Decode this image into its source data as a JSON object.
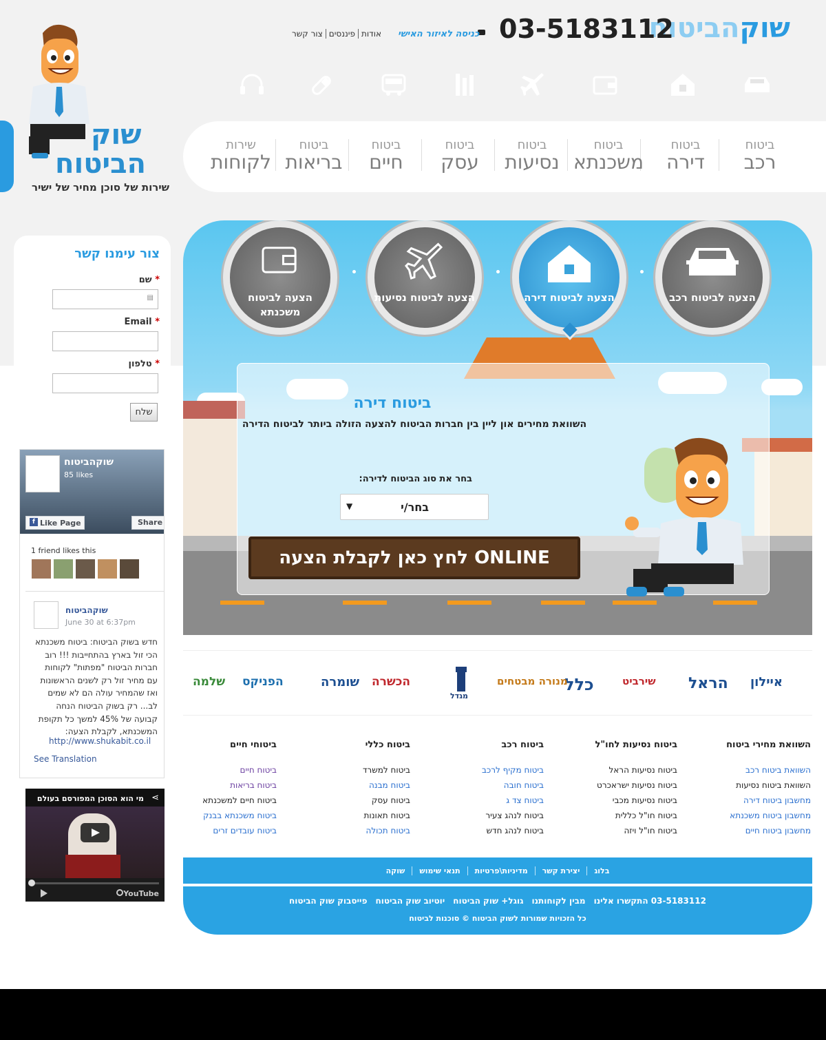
{
  "header": {
    "brand_part1": "שוק",
    "brand_part2": "הביטוח",
    "phone": "03-5183112",
    "login_link": "כניסה לאיזור האישי",
    "top_links": [
      "אודות",
      "פיננסים",
      "צור קשר"
    ]
  },
  "logo": {
    "line1": "שוק",
    "line2": "הביטוח",
    "tagline": "שירות של סוכן מחיר של ישיר"
  },
  "category_icons": [
    "car-icon",
    "home-icon",
    "wallet-icon",
    "plane-icon",
    "tools-icon",
    "bus-icon",
    "health-icon",
    "headset-icon"
  ],
  "nav": [
    {
      "top": "ביטוח",
      "bottom": "רכב"
    },
    {
      "top": "ביטוח",
      "bottom": "דירה"
    },
    {
      "top": "ביטוח",
      "bottom": "משכנתא"
    },
    {
      "top": "ביטוח",
      "bottom": "נסיעות"
    },
    {
      "top": "ביטוח",
      "bottom": "עסק"
    },
    {
      "top": "ביטוח",
      "bottom": "חיים"
    },
    {
      "top": "ביטוח",
      "bottom": "בריאות"
    },
    {
      "top": "שירות",
      "bottom": "לקוחות"
    }
  ],
  "hero": {
    "circles": [
      {
        "label": "הצעה לביטוח רכב",
        "icon": "car-icon",
        "active": false
      },
      {
        "label": "הצעה לביטוח דירה",
        "icon": "home-icon",
        "active": true
      },
      {
        "label": "הצעה לביטוח נסיעות",
        "icon": "plane-icon",
        "active": false
      },
      {
        "label": "הצעה לביטוח משכנתא",
        "icon": "wallet-icon",
        "active": false
      }
    ],
    "title": "ביטוח דירה",
    "subtitle": "השוואת מחירים און ליין בין חברות הביטוח להצעה הזולה ביותר לביטוח הדירה",
    "select_label": "בחר את סוג הביטוח לדירה:",
    "select_value": "בחר/י",
    "cta": "לחץ כאן לקבלת הצעה ONLINE"
  },
  "contact": {
    "title": "צור עימנו קשר",
    "name_label": "שם",
    "email_label": "Email",
    "phone_label": "טלפון",
    "required_mark": "*",
    "submit": "שלח"
  },
  "facebook": {
    "page_name": "שוקהביטוח",
    "likes": "85 likes",
    "like_button": "Like Page",
    "share_button": "Share",
    "friends": "1 friend likes this",
    "post_author": "שוקהביטוח",
    "post_date": "June 30 at 6:37pm",
    "post_text": "חדש בשוק הביטוח: ביטוח משכנתא הכי זול בארץ בהתחייבות !!! רוב חברות הביטוח \"מפתות\" לקוחות עם מחיר זול רק לשנים הראשונות ואז שהמחיר עולה הם לא שמים לב... רק בשוק הביטוח הנחה קבועה של 45% למשך כל תקופת המשכנתא, לקבלת הצעה:",
    "post_link": "http://www.shukabit.co.il",
    "translate": "See Translation"
  },
  "youtube": {
    "title": "מי הוא הסוכן המפורסם בעולם",
    "logo": "YouTube"
  },
  "partners": [
    "איילון",
    "הראל",
    "שירביט",
    "כלל",
    "מנורה מבטחים",
    "מגדל",
    "הכשרה",
    "שומרה",
    "הפניקס",
    "שלמה"
  ],
  "footer_columns": [
    {
      "heading": "השוואת מחירי ביטוח",
      "links": [
        {
          "text": "השוואת ביטוח רכב",
          "style": "blue"
        },
        {
          "text": "השוואת ביטוח נסיעות",
          "style": "dark"
        },
        {
          "text": "מחשבון ביטוח דירה",
          "style": "blue"
        },
        {
          "text": "מחשבון ביטוח משכנתא",
          "style": "blue"
        },
        {
          "text": "מחשבון ביטוח חיים",
          "style": "blue"
        }
      ]
    },
    {
      "heading": "ביטוח נסיעות לחו\"ל",
      "links": [
        {
          "text": "ביטוח נסיעות הראל",
          "style": "dark"
        },
        {
          "text": "ביטוח נסיעות ישראכרט",
          "style": "dark"
        },
        {
          "text": "ביטוח נסיעות מכבי",
          "style": "dark"
        },
        {
          "text": "ביטוח חו\"ל כללית",
          "style": "dark"
        },
        {
          "text": "ביטוח חו\"ל ויזה",
          "style": "dark"
        }
      ]
    },
    {
      "heading": "ביטוח רכב",
      "links": [
        {
          "text": "ביטוח מקיף לרכב",
          "style": "blue"
        },
        {
          "text": "ביטוח חובה",
          "style": "blue"
        },
        {
          "text": "ביטוח צד ג",
          "style": "blue"
        },
        {
          "text": "ביטוח לנהג צעיר",
          "style": "dark"
        },
        {
          "text": "ביטוח לנהג חדש",
          "style": "dark"
        }
      ]
    },
    {
      "heading": "ביטוח כללי",
      "links": [
        {
          "text": "ביטוח למשרד",
          "style": "dark"
        },
        {
          "text": "ביטוח מבנה",
          "style": "blue"
        },
        {
          "text": "ביטוח עסק",
          "style": "dark"
        },
        {
          "text": "ביטוח תאונות",
          "style": "dark"
        },
        {
          "text": "ביטוח תכולה",
          "style": "blue"
        }
      ]
    },
    {
      "heading": "ביטוחי חיים",
      "links": [
        {
          "text": "ביטוח חיים",
          "style": "purple"
        },
        {
          "text": "ביטוח בריאות",
          "style": "purple"
        },
        {
          "text": "ביטוח חיים למשכנתא",
          "style": "dark"
        },
        {
          "text": "ביטוח משכנתא בבנק",
          "style": "blue"
        },
        {
          "text": "ביטוח עובדים זרים",
          "style": "blue"
        }
      ]
    }
  ],
  "footer": {
    "links1": [
      "בלוג",
      "יצירת קשר",
      "מדיניות\\פרטיות",
      "תנאי שימוש",
      "שוקה"
    ],
    "links2": [
      "03-5183112 התקשרו אלינו",
      "מבין לקוחותנו",
      "גוגל+ שוק הביטוח",
      "יוטיוב שוק הביטוח",
      "פייסבוק שוק הביטוח"
    ],
    "copyright": "כל הזכויות שמורות לשוק הביטוח © סוכנות לביטוח"
  },
  "colors": {
    "accent": "#2a9be0",
    "cta": "#5b3a1f",
    "footer": "#2aa3e3"
  }
}
